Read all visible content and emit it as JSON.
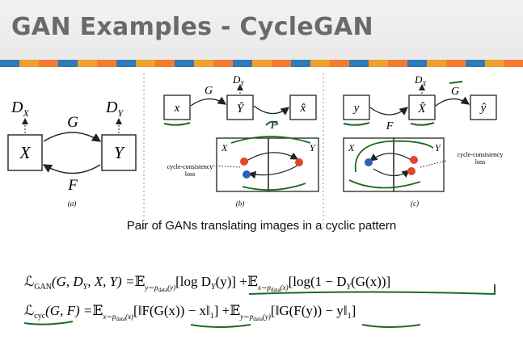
{
  "slide": {
    "title": "GAN Examples - CycleGAN",
    "caption": "Pair of GANs translating images in a cyclic pattern",
    "colors": {
      "title": "#6a6a6a",
      "stripe": [
        "#2f7ab8",
        "#f0a02c",
        "#f47c30"
      ],
      "annotation": "#1c6b22",
      "point_red": "#e2452b",
      "point_blue": "#2d5fc0"
    }
  },
  "figure": {
    "panel_a": {
      "node_x": "X",
      "node_y": "Y",
      "disc_x": "D",
      "disc_x_sub": "X",
      "disc_y": "D",
      "disc_y_sub": "Y",
      "map_g": "G",
      "map_f": "F",
      "sublabel": "(a)"
    },
    "panel_b": {
      "input": "x",
      "generated": "Ŷ",
      "recon": "x̂",
      "disc": "D",
      "disc_sub": "Y",
      "map_g": "G",
      "map_f": "F",
      "domain_x": "X",
      "domain_y": "Y",
      "loss_line1": "cycle-consistency",
      "loss_line2": "loss",
      "sublabel": "(b)"
    },
    "panel_c": {
      "input": "y",
      "generated": "X̂",
      "recon": "ŷ",
      "disc": "D",
      "disc_sub": "X",
      "map_g": "G",
      "map_f": "F",
      "domain_x": "X",
      "domain_y": "Y",
      "loss_line1": "cycle-consistency",
      "loss_line2": "loss",
      "sublabel": "(c)"
    }
  },
  "equations": {
    "gan": {
      "lhs_L": "ℒ",
      "lhs_sub": "GAN",
      "lhs_args": "(G, D",
      "lhs_args_sub": "Y",
      "lhs_args_tail": ", X, Y) =",
      "e1": "𝔼",
      "e1_sub": "y∼p",
      "e1_sub2": "data",
      "e1_sub3": "(y)",
      "t1": "[log D",
      "t1_sub": "Y",
      "t1_tail": "(y)] +",
      "e2": "𝔼",
      "e2_sub": "x∼p",
      "e2_sub2": "data",
      "e2_sub3": "(x)",
      "t2": "[log(1 − D",
      "t2_sub": "Y",
      "t2_tail": "(G(x))]"
    },
    "cyc": {
      "lhs_L": "ℒ",
      "lhs_sub": "cyc",
      "lhs_args": "(G, F) =",
      "e1": "𝔼",
      "e1_sub": "x∼p",
      "e1_sub2": "data",
      "e1_sub3": "(x)",
      "t1": "[‖F(G(x)) − x‖",
      "t1_sub": "1",
      "t1_tail": "] +",
      "e2": "𝔼",
      "e2_sub": "y∼p",
      "e2_sub2": "data",
      "e2_sub3": "(y)",
      "t2": "[‖G(F(y)) − y‖",
      "t2_sub": "1",
      "t2_tail": "]"
    }
  }
}
